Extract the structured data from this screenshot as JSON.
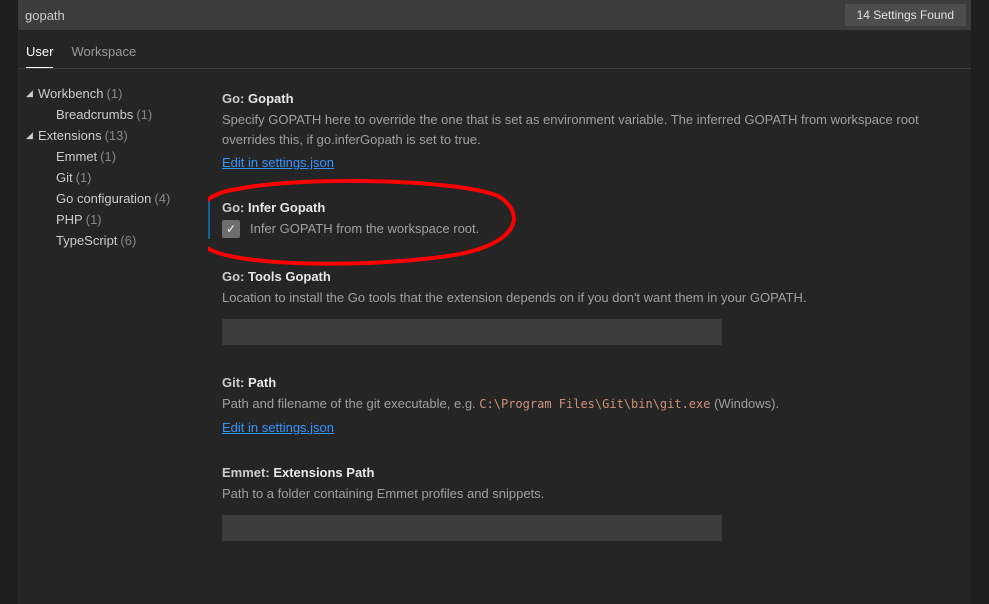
{
  "search": {
    "value": "gopath",
    "results_label": "14 Settings Found"
  },
  "tabs": {
    "user": "User",
    "workspace": "Workspace"
  },
  "sidebar": {
    "workbench": {
      "label": "Workbench",
      "count": "(1)"
    },
    "breadcrumbs": {
      "label": "Breadcrumbs",
      "count": "(1)"
    },
    "extensions": {
      "label": "Extensions",
      "count": "(13)"
    },
    "emmet": {
      "label": "Emmet",
      "count": "(1)"
    },
    "git": {
      "label": "Git",
      "count": "(1)"
    },
    "goconfig": {
      "label": "Go configuration",
      "count": "(4)"
    },
    "php": {
      "label": "PHP",
      "count": "(1)"
    },
    "typescript": {
      "label": "TypeScript",
      "count": "(6)"
    }
  },
  "settings": {
    "gopath": {
      "prefix": "Go:",
      "name": "Gopath",
      "desc": "Specify GOPATH here to override the one that is set as environment variable. The inferred GOPATH from workspace root overrides this, if go.inferGopath is set to true.",
      "edit_link": "Edit in settings.json"
    },
    "infer": {
      "prefix": "Go:",
      "name": "Infer Gopath",
      "desc": "Infer GOPATH from the workspace root."
    },
    "tools": {
      "prefix": "Go:",
      "name": "Tools Gopath",
      "desc": "Location to install the Go tools that the extension depends on if you don't want them in your GOPATH.",
      "value": ""
    },
    "gitpath": {
      "prefix": "Git:",
      "name": "Path",
      "desc_before": "Path and filename of the git executable, e.g. ",
      "desc_code": "C:\\Program Files\\Git\\bin\\git.exe",
      "desc_after": " (Windows).",
      "edit_link": "Edit in settings.json"
    },
    "emmet": {
      "prefix": "Emmet:",
      "name": "Extensions Path",
      "desc": "Path to a folder containing Emmet profiles and snippets.",
      "value": ""
    }
  }
}
